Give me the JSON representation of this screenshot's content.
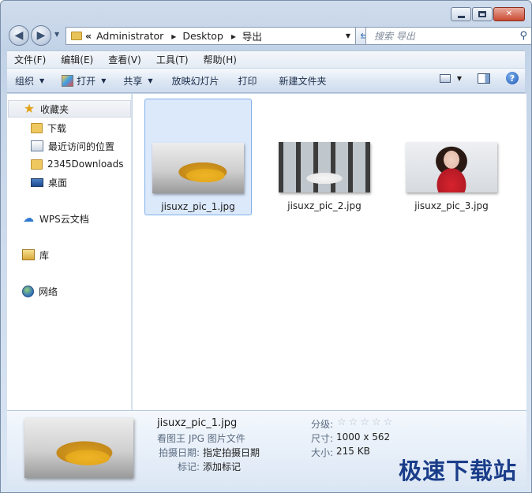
{
  "window": {
    "controls": {
      "minimize": "",
      "maximize": "",
      "close": "✕"
    }
  },
  "nav": {
    "back": "◀",
    "forward": "▶",
    "address": {
      "prefix": "«",
      "crumbs": [
        "Administrator",
        "Desktop",
        "导出"
      ]
    },
    "search": {
      "placeholder": "搜索 导出"
    }
  },
  "menu": [
    "文件(F)",
    "编辑(E)",
    "查看(V)",
    "工具(T)",
    "帮助(H)"
  ],
  "commands": {
    "organize": "组织",
    "open": "打开",
    "share": "共享",
    "slideshow": "放映幻灯片",
    "print": "打印",
    "new_folder": "新建文件夹"
  },
  "sidebar": {
    "favorites": "收藏夹",
    "items": [
      "下载",
      "最近访问的位置",
      "2345Downloads",
      "桌面"
    ],
    "wps": "WPS云文档",
    "library": "库",
    "network": "网络"
  },
  "files": [
    {
      "name": "jisuxz_pic_1.jpg",
      "thumb": "yellow-suv"
    },
    {
      "name": "jisuxz_pic_2.jpg",
      "thumb": "white-sports-car"
    },
    {
      "name": "jisuxz_pic_3.jpg",
      "thumb": "woman-portrait"
    }
  ],
  "details": {
    "filename": "jisuxz_pic_1.jpg",
    "filetype": "看图王 JPG 图片文件",
    "date_label": "拍摄日期:",
    "date_value": "指定拍摄日期",
    "tag_label": "标记:",
    "tag_value": "添加标记",
    "rating_label": "分级:",
    "rating": 0,
    "size_label": "尺寸:",
    "size_value": "1000 x 562",
    "filesize_label": "大小:",
    "filesize_value": "215 KB"
  },
  "watermark": "极速下载站"
}
